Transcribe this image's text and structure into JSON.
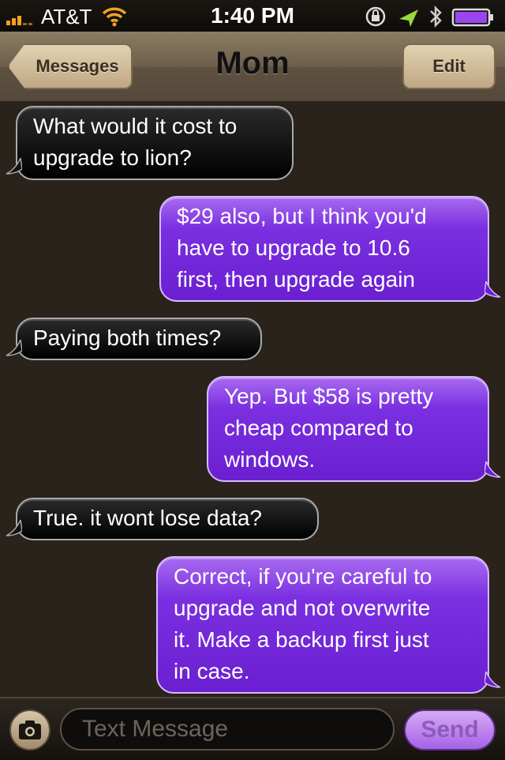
{
  "status_bar": {
    "carrier": "AT&T",
    "time": "1:40 PM",
    "icons": [
      "signal-icon",
      "wifi-icon",
      "rotation-lock-icon",
      "location-arrow-icon",
      "bluetooth-icon",
      "battery-icon"
    ],
    "accent_color": "#f2a21f"
  },
  "nav": {
    "back_label": "Messages",
    "title": "Mom",
    "edit_label": "Edit"
  },
  "messages": [
    {
      "direction": "incoming",
      "text": "What would it cost to\nupgrade to lion?"
    },
    {
      "direction": "outgoing",
      "text": "$29 also, but I think you'd\nhave to upgrade to 10.6\nfirst, then upgrade again"
    },
    {
      "direction": "incoming",
      "text": "Paying both times?"
    },
    {
      "direction": "outgoing",
      "text": "Yep. But $58 is pretty\ncheap compared to\nwindows."
    },
    {
      "direction": "incoming",
      "text": "True.  it wont lose data?"
    },
    {
      "direction": "outgoing",
      "text": "Correct, if you're careful to\nupgrade and not overwrite\nit. Make a backup first just\nin case."
    }
  ],
  "composer": {
    "placeholder": "Text Message",
    "send_label": "Send",
    "camera_icon": "camera-icon"
  },
  "colors": {
    "incoming_bubble": "#111111",
    "outgoing_bubble": "#7a2fe0",
    "nav_bar": "#6d5f4b",
    "background": "#2a231b"
  }
}
